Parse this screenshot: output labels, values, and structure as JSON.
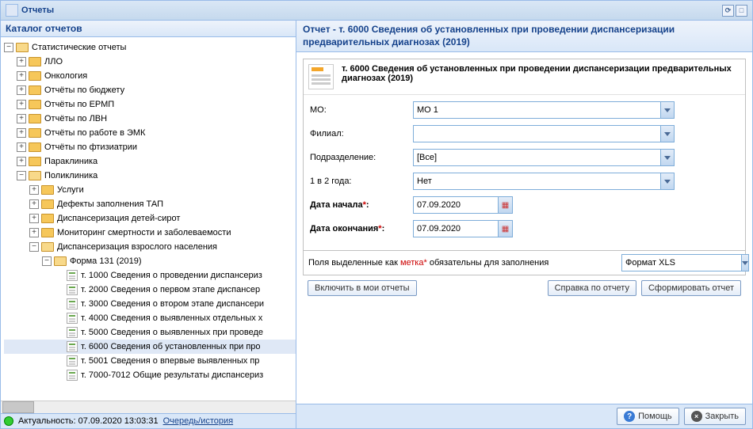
{
  "window_title": "Отчеты",
  "catalog_title": "Каталог отчетов",
  "tree": {
    "root": "Статистические отчеты",
    "items": [
      "ЛЛО",
      "Онкология",
      "Отчёты по бюджету",
      "Отчёты по ЕРМП",
      "Отчёты по ЛВН",
      "Отчёты по работе в ЭМК",
      "Отчёты по фтизиатрии",
      "Параклиника"
    ],
    "poliklinika": "Поликлиника",
    "poli_items": [
      "Услуги",
      "Дефекты заполнения ТАП",
      "Диспансеризация детей-сирот",
      "Мониторинг смертности и заболеваемости"
    ],
    "disp": "Диспансеризация взрослого населения",
    "form131": "Форма 131 (2019)",
    "reports": [
      "т. 1000 Сведения о проведении диспансериз",
      "т. 2000 Сведения о первом этапе диспансер",
      "т. 3000 Сведения о втором этапе диспансери",
      "т. 4000 Сведения о выявленных отдельных х",
      "т. 5000 Сведения о выявленных при проведе",
      "т. 6000 Сведения об установленных при про",
      "т. 5001 Сведения о впервые выявленных пр",
      "т. 7000-7012 Общие результаты диспансериз"
    ],
    "selected_index": 5
  },
  "status": {
    "actuality": "Актуальность: 07.09.2020 13:03:31",
    "queue": "Очередь/история"
  },
  "report": {
    "header": "Отчет - т. 6000 Сведения об установленных при проведении диспансеризации предварительных диагнозах (2019)",
    "info_title": "т. 6000 Сведения об установленных при проведении диспансеризации предварительных диагнозах (2019)",
    "fields": {
      "mo_label": "МО:",
      "mo_value": "МО 1",
      "filial_label": "Филиал:",
      "filial_value": "",
      "podr_label": "Подразделение:",
      "podr_value": "[Все]",
      "freq_label": "1 в 2 года:",
      "freq_value": "Нет",
      "date_start_label": "Дата начала",
      "date_start_value": "07.09.2020",
      "date_end_label": "Дата окончания",
      "date_end_value": "07.09.2020"
    },
    "note": "Поля выделенные как метка* обязательны для заполнения",
    "format_label": "Формат XLS",
    "btn_include": "Включить в мои отчеты",
    "btn_help_report": "Справка по отчету",
    "btn_form": "Сформировать отчет"
  },
  "footer": {
    "help": "Помощь",
    "close": "Закрыть"
  }
}
